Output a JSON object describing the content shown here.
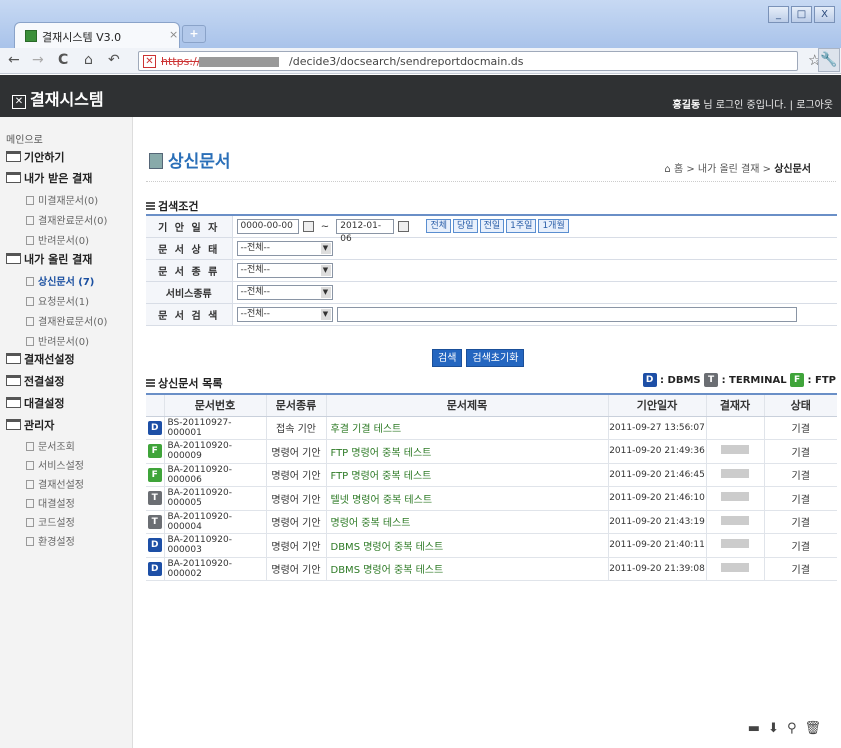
{
  "browser": {
    "tab_title": "결재시스템 V3.0",
    "tab_close": "×",
    "new_tab": "+",
    "window_buttons": [
      "_",
      "□",
      "X"
    ],
    "nav": [
      "←",
      "→",
      "C",
      "⌂",
      "↶"
    ],
    "url_scheme": "https://",
    "url_path": "/decide3/docsearch/sendreportdocmain.ds"
  },
  "header": {
    "logo": "결재시스템",
    "user_name": "홍길동",
    "user_text": " 님 로그인 중입니다. | 로그아웃"
  },
  "sidebar": {
    "home": "메인으로",
    "items": [
      {
        "label": "기안하기",
        "type": "top"
      },
      {
        "label": "내가 받은 결재",
        "type": "top"
      },
      {
        "label": "미결재문서(0)",
        "type": "sub"
      },
      {
        "label": "결재완료문서(0)",
        "type": "sub"
      },
      {
        "label": "반려문서(0)",
        "type": "sub"
      },
      {
        "label": "내가 올린 결재",
        "type": "top"
      },
      {
        "label": "상신문서 (7)",
        "type": "sub",
        "active": true
      },
      {
        "label": "요청문서(1)",
        "type": "sub"
      },
      {
        "label": "결재완료문서(0)",
        "type": "sub"
      },
      {
        "label": "반려문서(0)",
        "type": "sub"
      },
      {
        "label": "결재선설정",
        "type": "top"
      },
      {
        "label": "전결설정",
        "type": "top"
      },
      {
        "label": "대결설정",
        "type": "top"
      },
      {
        "label": "관리자",
        "type": "top"
      },
      {
        "label": "문서조회",
        "type": "sub"
      },
      {
        "label": "서비스설정",
        "type": "sub"
      },
      {
        "label": "결재선설정",
        "type": "sub"
      },
      {
        "label": "대결설정",
        "type": "sub"
      },
      {
        "label": "코드설정",
        "type": "sub"
      },
      {
        "label": "환경설정",
        "type": "sub"
      }
    ]
  },
  "main": {
    "title": "상신문서",
    "breadcrumb_home": "홈 > 내가 올린 결재 > ",
    "breadcrumb_current": "상신문서",
    "search_section": "검색조건",
    "search": {
      "date_label": "기 안 일 자",
      "date_from": "0000-00-00",
      "date_sep": "~",
      "date_to": "2012-01-06",
      "quick": [
        "전체",
        "당일",
        "전일",
        "1주일",
        "1개월"
      ],
      "status_label": "문 서 상 태",
      "status_value": "--전체--",
      "kind_label": "문 서 종 류",
      "kind_value": "--전체--",
      "service_label": "서비스종류",
      "service_value": "--전체--",
      "keyword_label": "문 서 검 색",
      "keyword_value": "--전체--"
    },
    "buttons": {
      "search": "검색",
      "reset": "검색초기화"
    },
    "list_section": "상신문서 목록",
    "legend": {
      "d": "D",
      "d_label": " : DBMS ",
      "t": "T",
      "t_label": " : TERMINAL ",
      "f": "F",
      "f_label": " : FTP"
    },
    "columns": [
      "문서번호",
      "문서종류",
      "문서제목",
      "기안일자",
      "결재자",
      "상태"
    ],
    "rows": [
      {
        "badge": "D",
        "no": "BS-20110927-000001",
        "kind": "접속 기안",
        "title": "후결 기결 테스트",
        "date": "2011-09-27 13:56:07",
        "status": "기결"
      },
      {
        "badge": "F",
        "no": "BA-20110920-000009",
        "kind": "명령어 기안",
        "title": "FTP 명령어 중복 테스트",
        "date": "2011-09-20 21:49:36",
        "status": "기결"
      },
      {
        "badge": "F",
        "no": "BA-20110920-000006",
        "kind": "명령어 기안",
        "title": "FTP 명령어 중복 테스트",
        "date": "2011-09-20 21:46:45",
        "status": "기결"
      },
      {
        "badge": "T",
        "no": "BA-20110920-000005",
        "kind": "명령어 기안",
        "title": "텔넷 명령어 중복 테스트",
        "date": "2011-09-20 21:46:10",
        "status": "기결"
      },
      {
        "badge": "T",
        "no": "BA-20110920-000004",
        "kind": "명령어 기안",
        "title": "명령어 중복 테스트",
        "date": "2011-09-20 21:43:19",
        "status": "기결"
      },
      {
        "badge": "D",
        "no": "BA-20110920-000003",
        "kind": "명령어 기안",
        "title": "DBMS 명령어 중복 테스트",
        "date": "2011-09-20 21:40:11",
        "status": "기결"
      },
      {
        "badge": "D",
        "no": "BA-20110920-000002",
        "kind": "명령어 기안",
        "title": "DBMS 명령어 중복 테스트",
        "date": "2011-09-20 21:39:08",
        "status": "기결"
      }
    ]
  },
  "colors": {
    "header_bg": "#2f3133",
    "accent": "#2466c0",
    "title": "#2a6fb8",
    "badge_d": "#1d4fa6",
    "badge_t": "#6b6e73",
    "badge_f": "#3fa43a"
  }
}
